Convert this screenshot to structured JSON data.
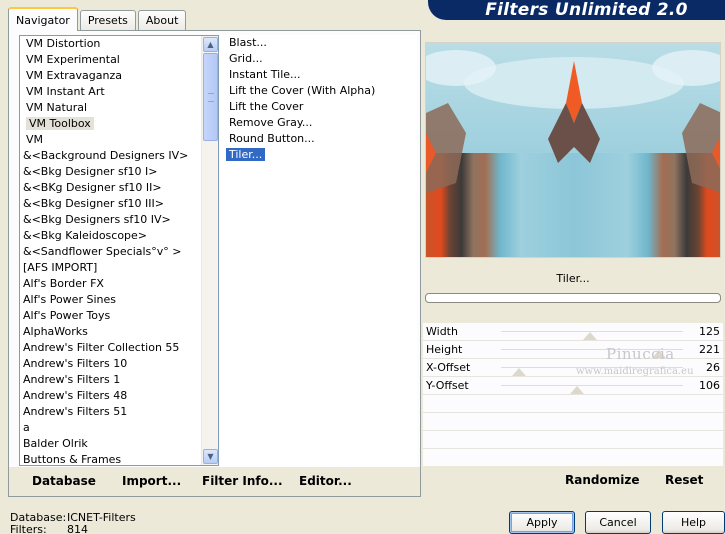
{
  "tabs": [
    "Navigator",
    "Presets",
    "About"
  ],
  "brand": "Filters Unlimited 2.0",
  "categories": [
    "VM Distortion",
    "VM Experimental",
    "VM Extravaganza",
    "VM Instant Art",
    "VM Natural",
    "VM Toolbox",
    "VM",
    "&<Background Designers IV>",
    "&<Bkg Designer sf10 I>",
    "&<BKg Designer sf10 II>",
    "&<Bkg Designer sf10 III>",
    "&<Bkg Designers sf10 IV>",
    "&<Bkg Kaleidoscope>",
    "&<Sandflower Specials°v° >",
    "[AFS IMPORT]",
    "Alf's Border FX",
    "Alf's Power Sines",
    "Alf's Power Toys",
    "AlphaWorks",
    "Andrew's Filter Collection 55",
    "Andrew's Filters 10",
    "Andrew's Filters 1",
    "Andrew's Filters 48",
    "Andrew's Filters 51",
    "a",
    "Balder Olrik",
    "Buttons & Frames"
  ],
  "selected_category": "VM Toolbox",
  "filters": [
    "Blast...",
    "Grid...",
    "Instant Tile...",
    "Lift the Cover (With Alpha)",
    "Lift the Cover",
    "Remove Gray...",
    "Round Button...",
    "Tiler..."
  ],
  "selected_filter": "Tiler...",
  "bottom_buttons": {
    "database": "Database",
    "import": "Import...",
    "filter_info": "Filter Info...",
    "editor": "Editor...",
    "randomize": "Randomize",
    "reset": "Reset"
  },
  "filter_name": "Tiler...",
  "params": [
    {
      "name": "Width",
      "value": "125",
      "level": 0.49
    },
    {
      "name": "Height",
      "value": "221",
      "level": 0.87
    },
    {
      "name": "X-Offset",
      "value": "26",
      "level": 0.1
    },
    {
      "name": "Y-Offset",
      "value": "106",
      "level": 0.42
    }
  ],
  "watermark": {
    "name": "Pinuccia",
    "site": "www.maidiregrafica.eu"
  },
  "status": {
    "database_label": "Database:",
    "database_value": "ICNET-Filters",
    "filters_label": "Filters:",
    "filters_value": "814"
  },
  "dialog_buttons": {
    "apply": "Apply",
    "cancel": "Cancel",
    "help": "Help"
  }
}
